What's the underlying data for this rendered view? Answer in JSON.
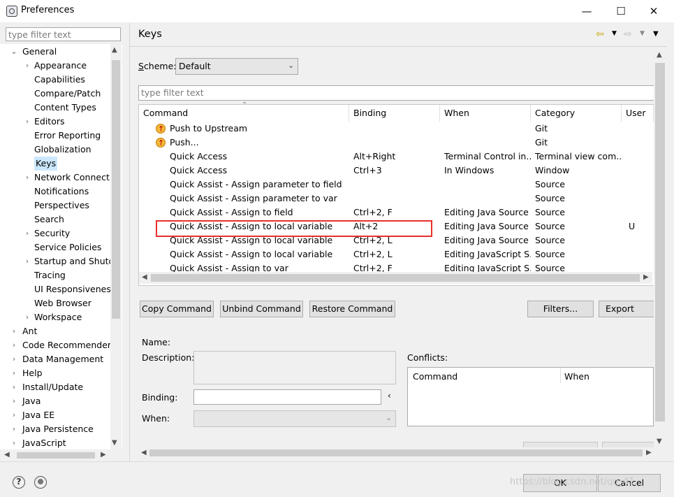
{
  "window": {
    "title": "Preferences",
    "minimize": "—",
    "maximize": "☐",
    "close": "✕"
  },
  "left": {
    "filter_placeholder": "type filter text",
    "tree": [
      {
        "label": "General",
        "level": 0,
        "arrow": "open"
      },
      {
        "label": "Appearance",
        "level": 1,
        "arrow": "closed"
      },
      {
        "label": "Capabilities",
        "level": 1,
        "arrow": ""
      },
      {
        "label": "Compare/Patch",
        "level": 1,
        "arrow": ""
      },
      {
        "label": "Content Types",
        "level": 1,
        "arrow": ""
      },
      {
        "label": "Editors",
        "level": 1,
        "arrow": "closed"
      },
      {
        "label": "Error Reporting",
        "level": 1,
        "arrow": ""
      },
      {
        "label": "Globalization",
        "level": 1,
        "arrow": ""
      },
      {
        "label": "Keys",
        "level": 1,
        "arrow": "",
        "selected": true
      },
      {
        "label": "Network Connecti",
        "level": 1,
        "arrow": "closed"
      },
      {
        "label": "Notifications",
        "level": 1,
        "arrow": ""
      },
      {
        "label": "Perspectives",
        "level": 1,
        "arrow": ""
      },
      {
        "label": "Search",
        "level": 1,
        "arrow": ""
      },
      {
        "label": "Security",
        "level": 1,
        "arrow": "closed"
      },
      {
        "label": "Service Policies",
        "level": 1,
        "arrow": ""
      },
      {
        "label": "Startup and Shutd",
        "level": 1,
        "arrow": "closed"
      },
      {
        "label": "Tracing",
        "level": 1,
        "arrow": ""
      },
      {
        "label": "UI Responsivenes",
        "level": 1,
        "arrow": ""
      },
      {
        "label": "Web Browser",
        "level": 1,
        "arrow": ""
      },
      {
        "label": "Workspace",
        "level": 1,
        "arrow": "closed"
      },
      {
        "label": "Ant",
        "level": 0,
        "arrow": "closed"
      },
      {
        "label": "Code Recommenders",
        "level": 0,
        "arrow": "closed"
      },
      {
        "label": "Data Management",
        "level": 0,
        "arrow": "closed"
      },
      {
        "label": "Help",
        "level": 0,
        "arrow": "closed"
      },
      {
        "label": "Install/Update",
        "level": 0,
        "arrow": "closed"
      },
      {
        "label": "Java",
        "level": 0,
        "arrow": "closed"
      },
      {
        "label": "Java EE",
        "level": 0,
        "arrow": "closed"
      },
      {
        "label": "Java Persistence",
        "level": 0,
        "arrow": "closed"
      },
      {
        "label": "JavaScript",
        "level": 0,
        "arrow": "closed"
      }
    ]
  },
  "page": {
    "title": "Keys",
    "scheme_label": "Scheme:",
    "scheme_value": "Default",
    "filter_placeholder": "type filter text",
    "columns": [
      "Command",
      "Binding",
      "When",
      "Category",
      "User"
    ],
    "rows": [
      {
        "icon": "git-push-icon",
        "command": "Push to Upstream",
        "binding": "",
        "when": "",
        "category": "Git",
        "user": ""
      },
      {
        "icon": "git-push-icon",
        "command": "Push...",
        "binding": "",
        "when": "",
        "category": "Git",
        "user": ""
      },
      {
        "icon": "",
        "command": "Quick Access",
        "binding": "Alt+Right",
        "when": "Terminal Control in...",
        "category": "Terminal view com...",
        "user": ""
      },
      {
        "icon": "",
        "command": "Quick Access",
        "binding": "Ctrl+3",
        "when": "In Windows",
        "category": "Window",
        "user": ""
      },
      {
        "icon": "",
        "command": "Quick Assist - Assign parameter to field",
        "binding": "",
        "when": "",
        "category": "Source",
        "user": ""
      },
      {
        "icon": "",
        "command": "Quick Assist - Assign parameter to var",
        "binding": "",
        "when": "",
        "category": "Source",
        "user": ""
      },
      {
        "icon": "",
        "command": "Quick Assist - Assign to field",
        "binding": "Ctrl+2, F",
        "when": "Editing Java Source",
        "category": "Source",
        "user": ""
      },
      {
        "icon": "",
        "command": "Quick Assist - Assign to local variable",
        "binding": "Alt+2",
        "when": "Editing Java Source",
        "category": "Source",
        "user": "U"
      },
      {
        "icon": "",
        "command": "Quick Assist - Assign to local variable",
        "binding": "Ctrl+2, L",
        "when": "Editing Java Source",
        "category": "Source",
        "user": ""
      },
      {
        "icon": "",
        "command": "Quick Assist - Assign to local variable",
        "binding": "Ctrl+2, L",
        "when": "Editing JavaScript S...",
        "category": "Source",
        "user": ""
      },
      {
        "icon": "",
        "command": "Quick Assist - Assign to var",
        "binding": "Ctrl+2, F",
        "when": "Editing JavaScript S...",
        "category": "Source",
        "user": ""
      }
    ],
    "buttons": {
      "copy": "Copy Command",
      "unbind": "Unbind Command",
      "restore": "Restore Command",
      "filters": "Filters...",
      "export": "Export CSV..."
    },
    "details": {
      "name_label": "Name:",
      "description_label": "Description:",
      "binding_label": "Binding:",
      "when_label": "When:",
      "conflicts_label": "Conflicts:",
      "conflicts_columns": [
        "Command",
        "When"
      ]
    }
  },
  "footer": {
    "ok": "OK",
    "cancel": "Cancel",
    "help_icon": "?",
    "watermark": "https://blog.csdn.net/qq_41..."
  }
}
